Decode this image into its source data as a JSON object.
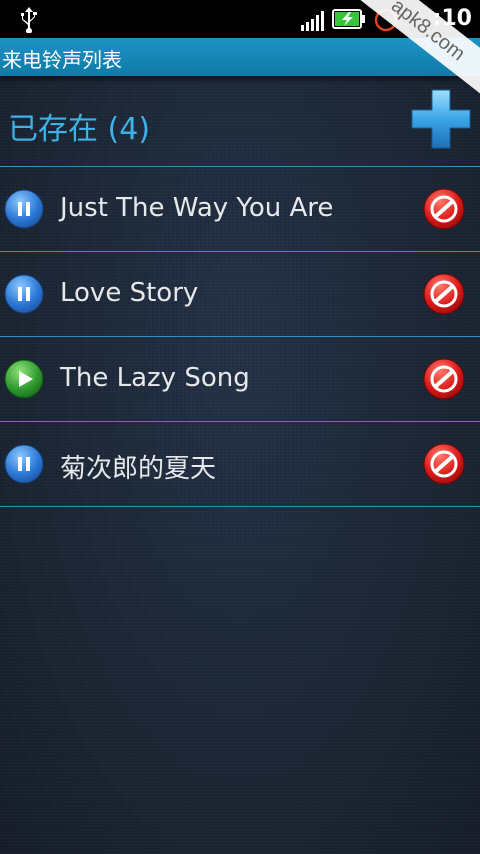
{
  "status_bar": {
    "clock": ":10",
    "icons": [
      "usb-icon",
      "signal-icon",
      "battery-charging-icon",
      "alarm-icon"
    ]
  },
  "watermark": {
    "text": "apk8.com"
  },
  "title_bar": {
    "title": "来电铃声列表"
  },
  "header": {
    "title": "已存在 (4)"
  },
  "songs": [
    {
      "title": "Just The Way You Are",
      "state": "pause",
      "icon": "pause-icon"
    },
    {
      "title": "Love Story",
      "state": "pause",
      "icon": "pause-icon"
    },
    {
      "title": "The Lazy Song",
      "state": "play",
      "icon": "play-icon"
    },
    {
      "title": "菊次郎的夏天",
      "state": "pause",
      "icon": "pause-icon"
    }
  ],
  "colors": {
    "accent": "#3db2e8",
    "title_bar": "#1489bb",
    "divider": "#2f8fc4",
    "pause_button": "#2b78d6",
    "play_button": "#2f9a2f",
    "delete_button": "#d81818"
  }
}
